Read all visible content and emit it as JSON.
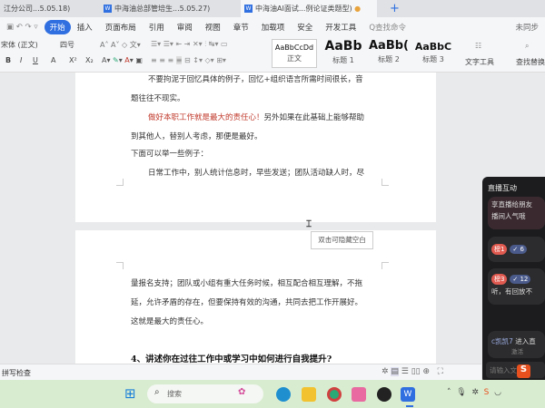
{
  "tabs": [
    {
      "label": "江分公司...5.05.18)"
    },
    {
      "label": "中海油总部管培生...5.05.27)"
    },
    {
      "label": "中海油AI面试...例论证类题型)"
    }
  ],
  "new_tab": "+",
  "menu": [
    "开始",
    "插入",
    "页面布局",
    "引用",
    "审阅",
    "视图",
    "章节",
    "加载项",
    "安全",
    "开发工具"
  ],
  "search_cmd": "Q查找命令",
  "sync": "未同步",
  "font": {
    "name": "宋体 (正文)",
    "size": "四号"
  },
  "format_buttons": [
    "B",
    "I",
    "U",
    "A",
    "X²",
    "X₂"
  ],
  "styles": [
    {
      "sample": "AaBbCcDd",
      "label": "正文"
    },
    {
      "sample": "AaBb",
      "label": "标题 1"
    },
    {
      "sample": "AaBb(",
      "label": "标题 2"
    },
    {
      "sample": "AaBbC",
      "label": "标题 3"
    }
  ],
  "text_tools": "文字工具",
  "find_replace": "查找替换",
  "page1": [
    "不要拘泥于回忆具体的例子，回忆+组织语言所需时间很长，音",
    "题往往不现实。",
    "做好本职工作就是最大的责任心！",
    "另外如果在此基础上能够帮助",
    "到其他人，替别人考虑，那便是最好。",
    "下面可以举一些例子：",
    "日常工作中，别人统计信息时，早些发送；团队活动缺人时，尽"
  ],
  "tooltip": "双击可隐藏空白",
  "page2": [
    "量报名支持；团队或小组有重大任务时候，相互配合相互理解，不拖",
    "延，允许矛盾的存在，但要保持有效的沟通，共同去把工作开展好。",
    "这就是最大的责任心。",
    "4、讲述你在过往工作中或学习中如何进行自我提升?"
  ],
  "status": {
    "spellcheck": "拼写检查"
  },
  "live": {
    "title": "直播互动",
    "msg1": "享直播给朋友",
    "msg1b": "播间人气哦",
    "rank1": "榜1",
    "like1": "6",
    "rank3": "榜3",
    "like3": "12",
    "msg3": "听，有回放不",
    "user": "c凯凯7",
    "user_msg": "进入直",
    "activate": "激活",
    "input_placeholder": "请输入文"
  },
  "taskbar": {
    "search": "搜索"
  },
  "colors": {
    "accent": "#2f6fe0",
    "red_text": "#c0392b"
  }
}
